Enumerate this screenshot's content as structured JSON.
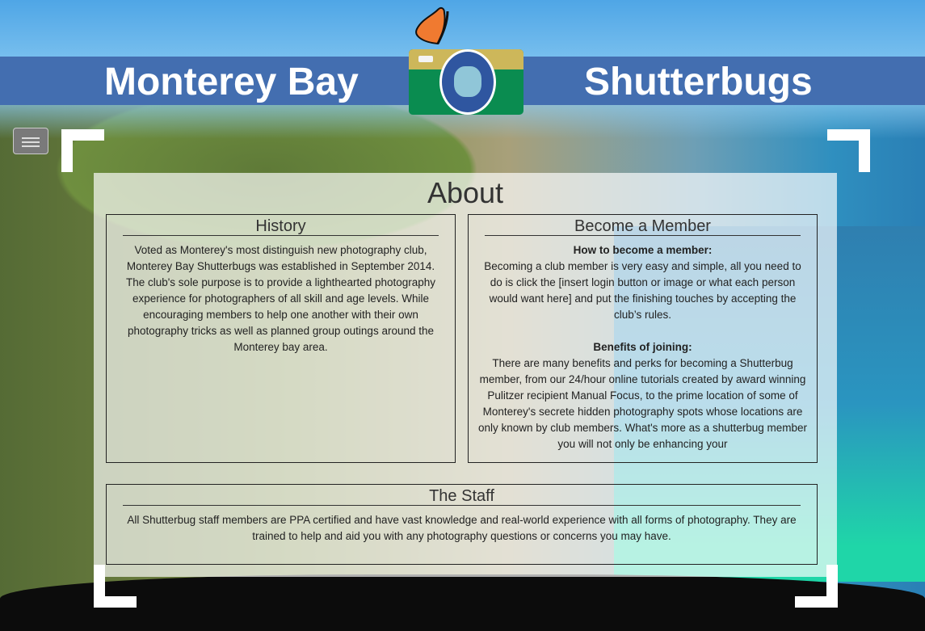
{
  "header": {
    "left_title": "Monterey Bay",
    "right_title": "Shutterbugs",
    "logo": "camera-butterfly-logo"
  },
  "nav": {
    "menu_icon": "hamburger-icon"
  },
  "page": {
    "title": "About"
  },
  "history": {
    "heading": "History",
    "text": "Voted as Monterey's most distinguish new photography club, Monterey Bay Shutterbugs was established in September 2014. The club's sole purpose is to provide a lighthearted photography experience for photographers of all skill and age levels. While encouraging members to help one another with their own photography tricks as well as planned group outings around the Monterey bay area."
  },
  "member": {
    "heading": "Become a Member",
    "sub1": "How to become a member:",
    "text1": "Becoming a club member is very easy and simple, all you need to do is click the [insert login button or image or what each person would want here] and put the finishing touches by accepting the club’s rules.",
    "sub2": "Benefits of joining:",
    "text2": "There are many benefits and perks for becoming a Shutterbug member, from our 24/hour online tutorials created by award winning Pulitzer recipient Manual Focus, to the prime location of some of Monterey's secrete hidden photography spots whose locations are only known by club members. What's more as a shutterbug member you will not only be enhancing your"
  },
  "staff": {
    "heading": "The Staff",
    "text": "All Shutterbug staff members are PPA certified and have vast knowledge and real-world experience with all forms of photography. They are trained to help and aid you with any photography questions or concerns you may have."
  }
}
